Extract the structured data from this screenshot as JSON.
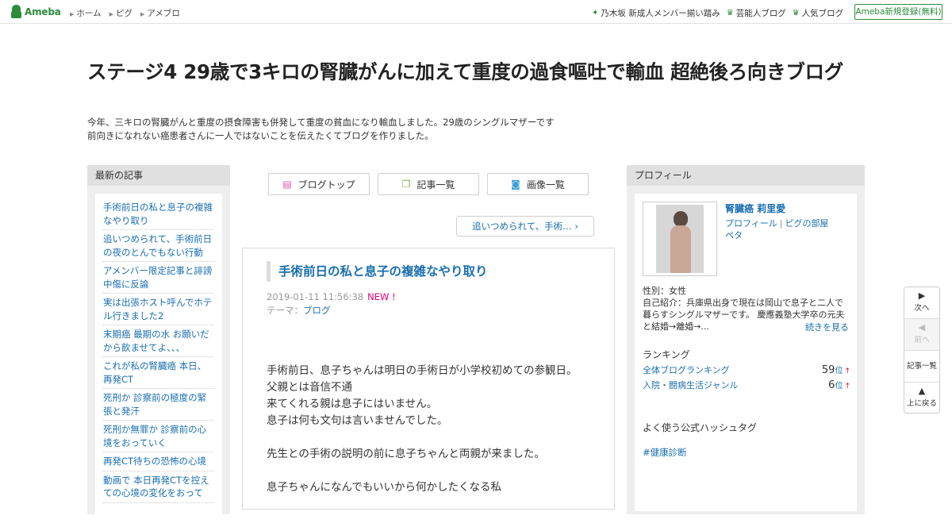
{
  "topbar": {
    "logo": "Ameba",
    "nav": [
      "ホーム",
      "ピグ",
      "アメブロ"
    ],
    "right_links": [
      {
        "icon": "sparkle-icon",
        "label": "乃木坂 新成人メンバー揃い踏み"
      },
      {
        "icon": "crown-icon",
        "label": "芸能人ブログ"
      },
      {
        "icon": "crown-icon",
        "label": "人気ブログ"
      }
    ],
    "signup": "Ameba新規登録(無料)"
  },
  "header": {
    "title": "ステージ4 29歳で3キロの腎臓がんに加えて重度の過食嘔吐で輸血 超絶後ろ向きブログ",
    "desc_line1": "今年、三キロの腎臓がんと重度の摂食障害も併発して重度の貧血になり輸血しました。29歳のシングルマザーです",
    "desc_line2": "前向きになれない癌患者さんに一人ではないことを伝えたくてブログを作りました。"
  },
  "recent": {
    "heading": "最新の記事",
    "items": [
      "手術前日の私と息子の複雑なやり取り",
      "追いつめられて、手術前日の夜のとんでもない行動",
      "アメンバー限定記事と誹謗中傷に反論",
      "実は出張ホスト呼んでホテル行きました2",
      "末期癌 最期の水 お願いだから飲ませてよ、、、",
      "これが私の腎臓癌 本日、再発CT",
      "死刑か 診察前の極度の緊張と発汗",
      "死刑か無罪か 診察前の心境をおっていく",
      "再発CT待ちの恐怖の心境",
      "動画で 本日再発CTを控えての心境の変化をおって"
    ]
  },
  "buttons": {
    "top": "ブログトップ",
    "list": "記事一覧",
    "images": "画像一覧"
  },
  "next_article": "追いつめられて、手術…",
  "article": {
    "title": "手術前日の私と息子の複雑なやり取り",
    "date": "2019-01-11 11:56:38",
    "new_badge": "NEW !",
    "theme_label": "テーマ：",
    "theme": "ブログ",
    "body": [
      "手術前日、息子ちゃんは明日の手術日が小学校初めての参観日。",
      "父親とは音信不通",
      "来てくれる親は息子にはいません。",
      "息子は何も文句は言いませんでした。",
      "",
      "先生との手術の説明の前に息子ちゃんと両親が来ました。",
      "",
      "息子ちゃんになんでもいいから何かしたくなる私"
    ]
  },
  "profile": {
    "heading": "プロフィール",
    "name": "腎臓癌 莉里愛",
    "link_profile": "プロフィール",
    "link_pig": "ピグの部屋",
    "link_peta": "ペタ",
    "sex": "性別：女性",
    "intro": "自己紹介：兵庫県出身で現在は岡山で息子と二人で暮らすシングルマザーです。 慶應義塾大学卒の元夫と結婚→離婚→...",
    "more": "続きを見る",
    "ranking_heading": "ランキング",
    "rankings": [
      {
        "label": "全体ブログランキング",
        "value": "59",
        "unit": "位",
        "arrow": "↑"
      },
      {
        "label": "入院・闘病生活ジャンル",
        "value": "6",
        "unit": "位",
        "arrow": "↑"
      }
    ],
    "hashtag_heading": "よく使う公式ハッシュタグ",
    "hashtag": "#健康診断"
  },
  "float_nav": {
    "next": "次へ",
    "prev": "前へ",
    "list": "記事一覧",
    "top": "上に戻る"
  }
}
